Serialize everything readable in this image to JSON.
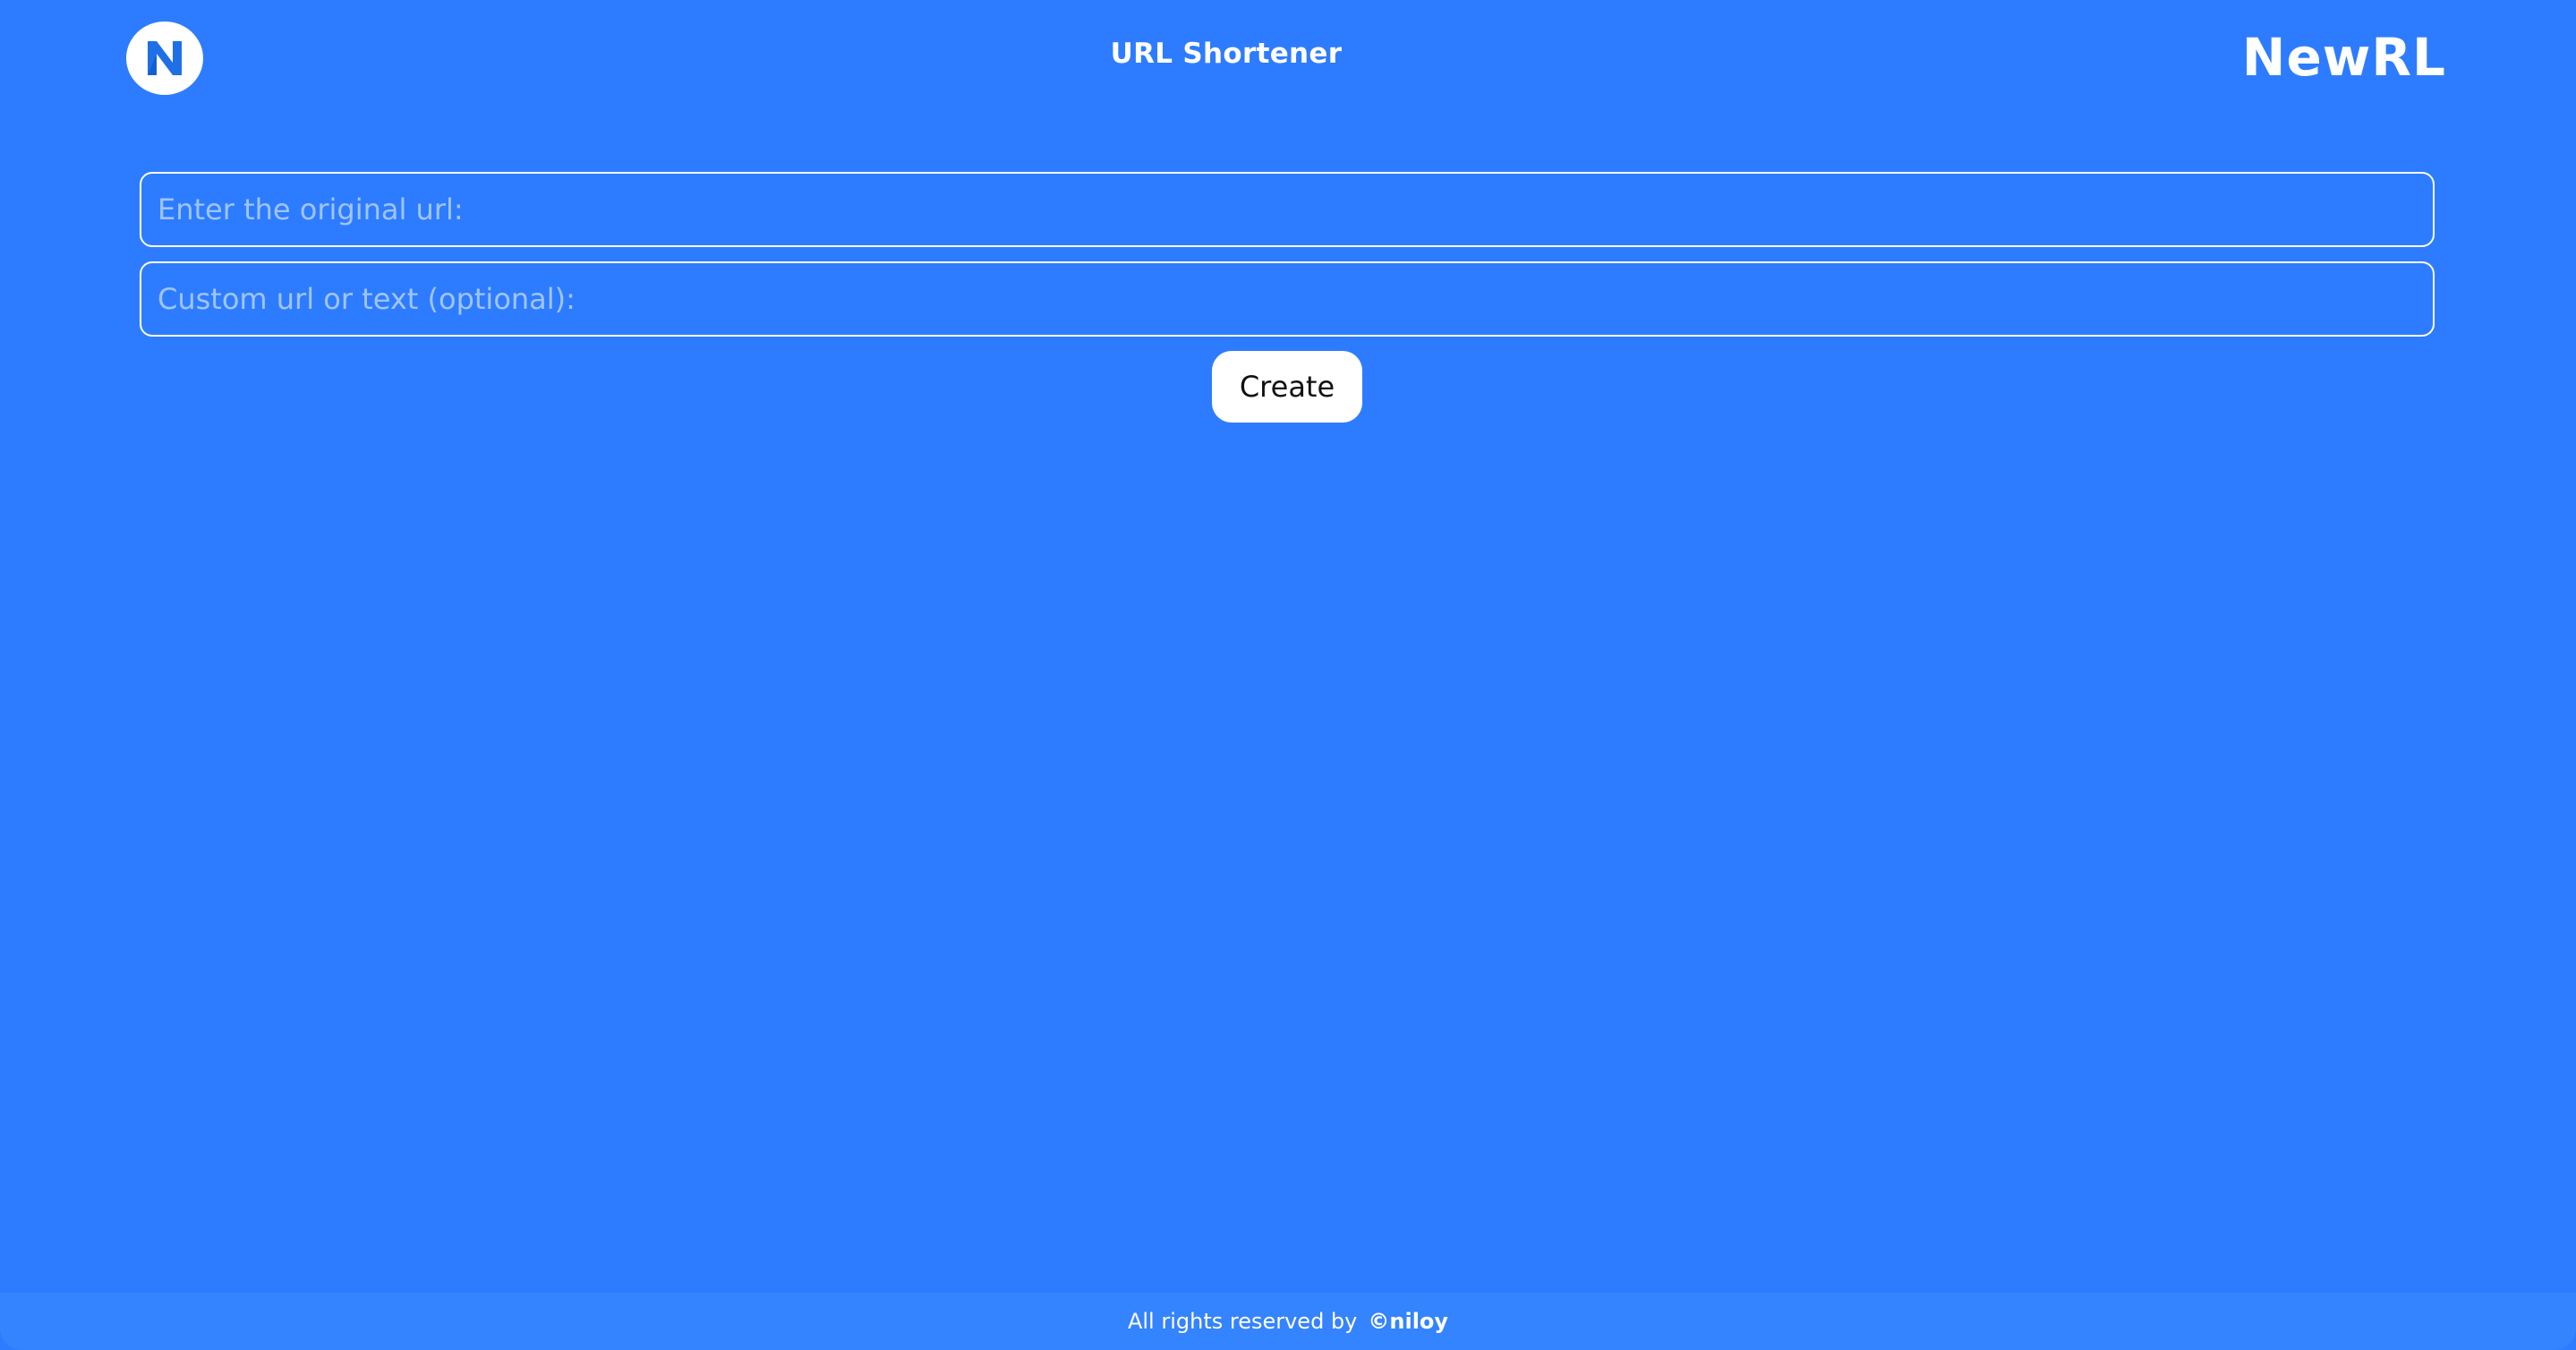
{
  "header": {
    "title": "URL Shortener",
    "brand": "NewRL",
    "logo_icon": "newrl-logo-icon"
  },
  "form": {
    "original_url": {
      "value": "",
      "placeholder": "Enter the original url:"
    },
    "custom_url": {
      "value": "",
      "placeholder": "Custom url or text (optional):"
    },
    "create_label": "Create"
  },
  "footer": {
    "text": "All rights reserved by",
    "author": "©niloy"
  },
  "colors": {
    "background": "#2d7cff",
    "footer_background": "#3483ff",
    "logo_accent": "#1f6fe6",
    "text": "#ffffff",
    "button_background": "#ffffff",
    "button_text": "#111111"
  }
}
